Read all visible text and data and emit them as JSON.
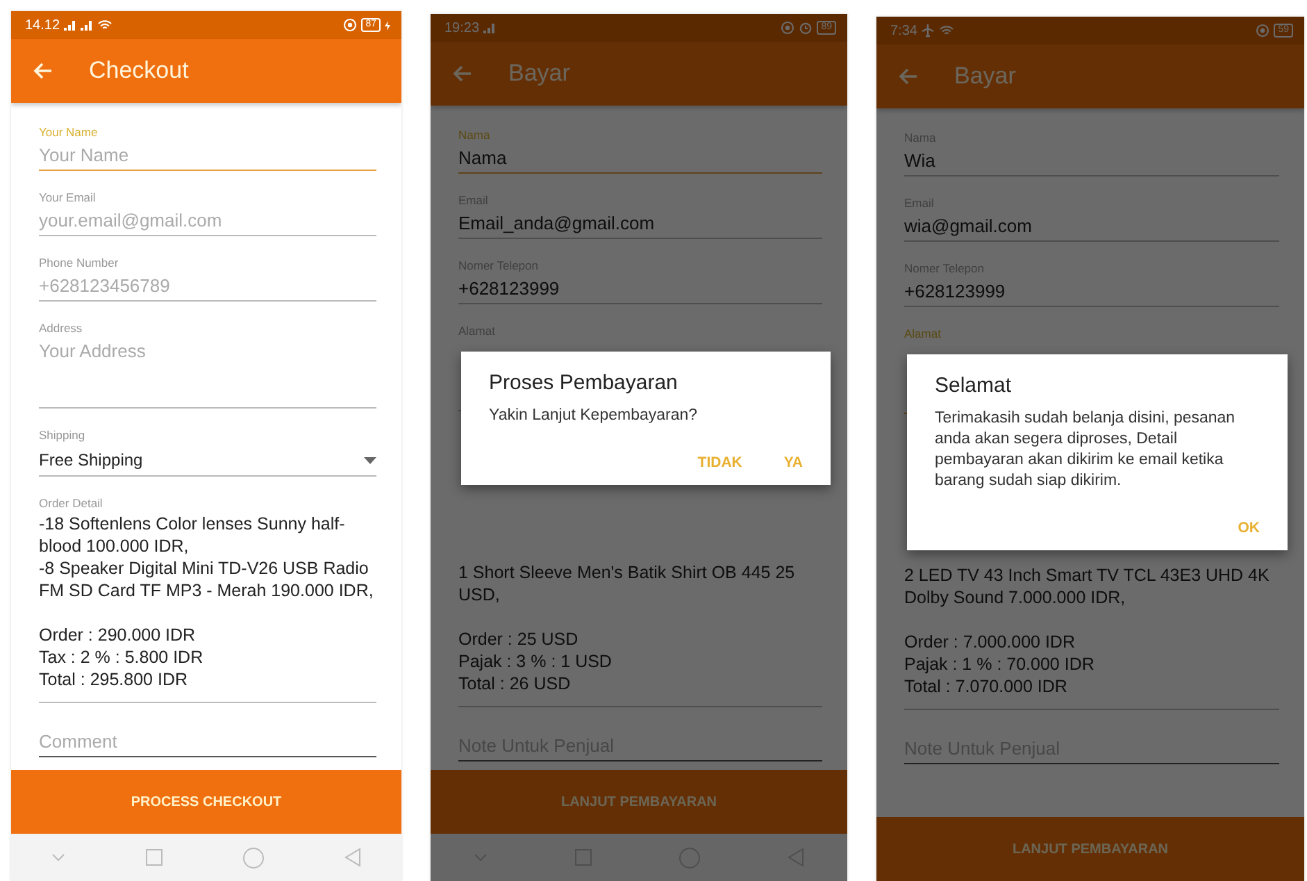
{
  "phones": [
    {
      "status": {
        "time": "14.12",
        "battery": "87",
        "charging": true
      },
      "title": "Checkout",
      "fields": [
        {
          "label": "Your Name",
          "placeholder": "Your Name",
          "kind": "text",
          "focused": true
        },
        {
          "label": "Your Email",
          "placeholder": "your.email@gmail.com",
          "kind": "text",
          "focused": false
        },
        {
          "label": "Phone Number",
          "placeholder": "+628123456789",
          "kind": "text",
          "focused": false
        },
        {
          "label": "Address",
          "placeholder": "Your Address",
          "kind": "textarea",
          "focused": false
        }
      ],
      "shipping": {
        "label": "Shipping",
        "value": "Free Shipping"
      },
      "order": {
        "label": "Order Detail",
        "items": [
          "-18 Softenlens Color lenses Sunny half-blood 100.000 IDR,",
          "-8 Speaker Digital Mini TD-V26 USB Radio FM SD Card TF MP3 - Merah 190.000 IDR,"
        ],
        "summary": [
          "Order : 290.000 IDR",
          "Tax : 2 % : 5.800 IDR",
          "Total : 295.800 IDR"
        ]
      },
      "note": {
        "placeholder": "Comment"
      },
      "button": "PROCESS CHECKOUT",
      "nav_bar": true
    },
    {
      "status": {
        "time": "19:23",
        "battery": "89"
      },
      "title": "Bayar",
      "fields": [
        {
          "label": "Nama",
          "value": "Nama",
          "kind": "text",
          "focused": true
        },
        {
          "label": "Email",
          "value": "Email_anda@gmail.com",
          "kind": "text",
          "focused": false
        },
        {
          "label": "Nomer Telepon",
          "value": "+628123999",
          "kind": "text",
          "focused": false
        },
        {
          "label": "Alamat",
          "kind": "textarea",
          "focused": false
        }
      ],
      "order": {
        "items": [
          "1 Short Sleeve Men's Batik Shirt OB 445 25 USD,"
        ],
        "summary": [
          "Order : 25 USD",
          "Pajak : 3 % : 1 USD",
          "Total : 26 USD"
        ]
      },
      "note": {
        "placeholder": "Note Untuk Penjual"
      },
      "button": "LANJUT PEMBAYARAN",
      "nav_bar": true,
      "dialog": {
        "title": "Proses Pembayaran",
        "message": "Yakin Lanjut Kepembayaran?",
        "buttons": [
          "TIDAK",
          "YA"
        ]
      }
    },
    {
      "status": {
        "time": "7:34",
        "battery": "59"
      },
      "title": "Bayar",
      "fields": [
        {
          "label": "Nama",
          "value": "Wia",
          "kind": "text",
          "focused": false
        },
        {
          "label": "Email",
          "value": "wia@gmail.com",
          "kind": "text",
          "focused": false
        },
        {
          "label": "Nomer Telepon",
          "value": "+628123999",
          "kind": "text",
          "focused": false
        },
        {
          "label": "Alamat",
          "kind": "textarea",
          "focused": true
        }
      ],
      "order": {
        "items": [
          "2 LED TV 43 Inch Smart TV TCL 43E3 UHD 4K Dolby Sound 7.000.000 IDR,"
        ],
        "summary": [
          "Order : 7.000.000 IDR",
          "Pajak : 1 % : 70.000 IDR",
          "Total : 7.070.000 IDR"
        ]
      },
      "note": {
        "placeholder": "Note Untuk Penjual"
      },
      "button": "LANJUT PEMBAYARAN",
      "dialog": {
        "title": "Selamat",
        "message": "Terimakasih sudah belanja disini, pesanan anda akan segera diproses, Detail pembayaran akan dikirim ke email ketika barang sudah siap dikirim.",
        "buttons": [
          "OK"
        ]
      }
    }
  ]
}
